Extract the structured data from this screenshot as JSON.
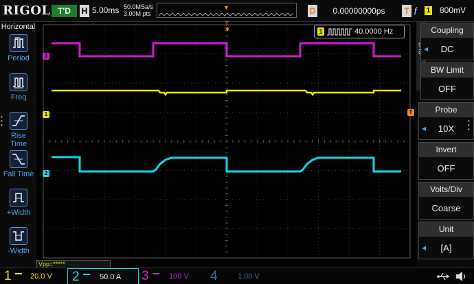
{
  "header": {
    "logo": "RIGOL",
    "run_state": "T'D",
    "horizontal_letter": "H",
    "timebase": "5.00ms",
    "sample_rate": "50.0MSa/s",
    "memory_depth": "3.00M pts",
    "delay_letter": "D",
    "delay_value": "0.00000000ps",
    "trigger_letter": "T",
    "trigger_edge": "ƒ",
    "trigger_source": "1",
    "trigger_level": "800mV"
  },
  "left_menu": {
    "title": "Horizontal",
    "items": [
      {
        "label": "Period",
        "icon": "period-icon"
      },
      {
        "label": "Freq",
        "icon": "freq-icon"
      },
      {
        "label": "Rise Time",
        "icon": "rise-time-icon"
      },
      {
        "label": "Fall Time",
        "icon": "fall-time-icon"
      },
      {
        "label": "+Width",
        "icon": "positive-width-icon"
      },
      {
        "label": "-Width",
        "icon": "negative-width-icon"
      }
    ]
  },
  "measurement": {
    "channel": "1",
    "frequency": "40.0000 Hz",
    "vpp_readout": "Vpp=*****"
  },
  "markers": {
    "ch1": "1",
    "ch2": "2",
    "ch3": "3",
    "trigger": "T"
  },
  "right_menu": {
    "tab": "CH2",
    "items": [
      {
        "title": "Coupling",
        "value": "DC"
      },
      {
        "title": "BW Limit",
        "value": "OFF"
      },
      {
        "title": "Probe",
        "value": "10X"
      },
      {
        "title": "Invert",
        "value": "OFF"
      },
      {
        "title": "Volts/Div",
        "value": "Coarse"
      },
      {
        "title": "Unit",
        "value": "[A]"
      }
    ]
  },
  "channels": [
    {
      "number": "1",
      "scale": "20.0 V",
      "color": "#e6e600"
    },
    {
      "number": "2",
      "scale": "50.0 A",
      "color": "#12d6e6"
    },
    {
      "number": "3",
      "scale": "100 V",
      "color": "#d21cd2"
    },
    {
      "number": "4",
      "scale": "1.00 V",
      "color": "#3a6fa8"
    }
  ],
  "colors": {
    "accent_blue": "#4ea6e8",
    "trigger_orange": "#f08a1e",
    "ch1": "#e6e600",
    "ch2": "#12d6e6",
    "ch3": "#d21cd2",
    "ch4": "#3a6fa8"
  }
}
